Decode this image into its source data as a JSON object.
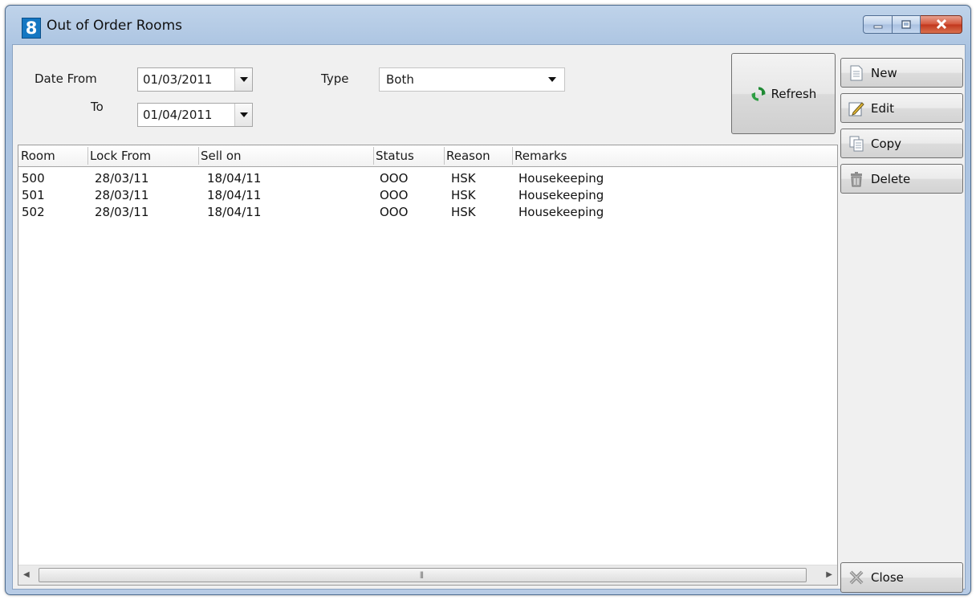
{
  "window": {
    "title": "Out of Order Rooms",
    "app_icon_glyph": "8",
    "controls": [
      "minimize-icon",
      "maximize-icon",
      "close-icon"
    ]
  },
  "filters": {
    "date_from_label": "Date From",
    "date_from_value": "01/03/2011",
    "to_label": "To",
    "to_value": "01/04/2011",
    "type_label": "Type",
    "type_value": "Both"
  },
  "buttons": {
    "refresh": "Refresh",
    "new": "New",
    "edit": "Edit",
    "copy": "Copy",
    "delete": "Delete",
    "close": "Close"
  },
  "table": {
    "columns": [
      "Room",
      "Lock From",
      "Sell on",
      "Status",
      "Reason",
      "Remarks"
    ],
    "rows": [
      [
        "500",
        "28/03/11",
        "18/04/11",
        "OOO",
        "HSK",
        "Housekeeping"
      ],
      [
        "501",
        "28/03/11",
        "18/04/11",
        "OOO",
        "HSK",
        "Housekeeping"
      ],
      [
        "502",
        "28/03/11",
        "18/04/11",
        "OOO",
        "HSK",
        "Housekeeping"
      ]
    ]
  },
  "scrollbar": {
    "left_arrow": "◀",
    "right_arrow": "▶",
    "grip": "⦀"
  },
  "colors": {
    "refresh_icon": "#1f8a34",
    "titlebar": "#b7cbe5",
    "close_button": "#c8452a"
  }
}
